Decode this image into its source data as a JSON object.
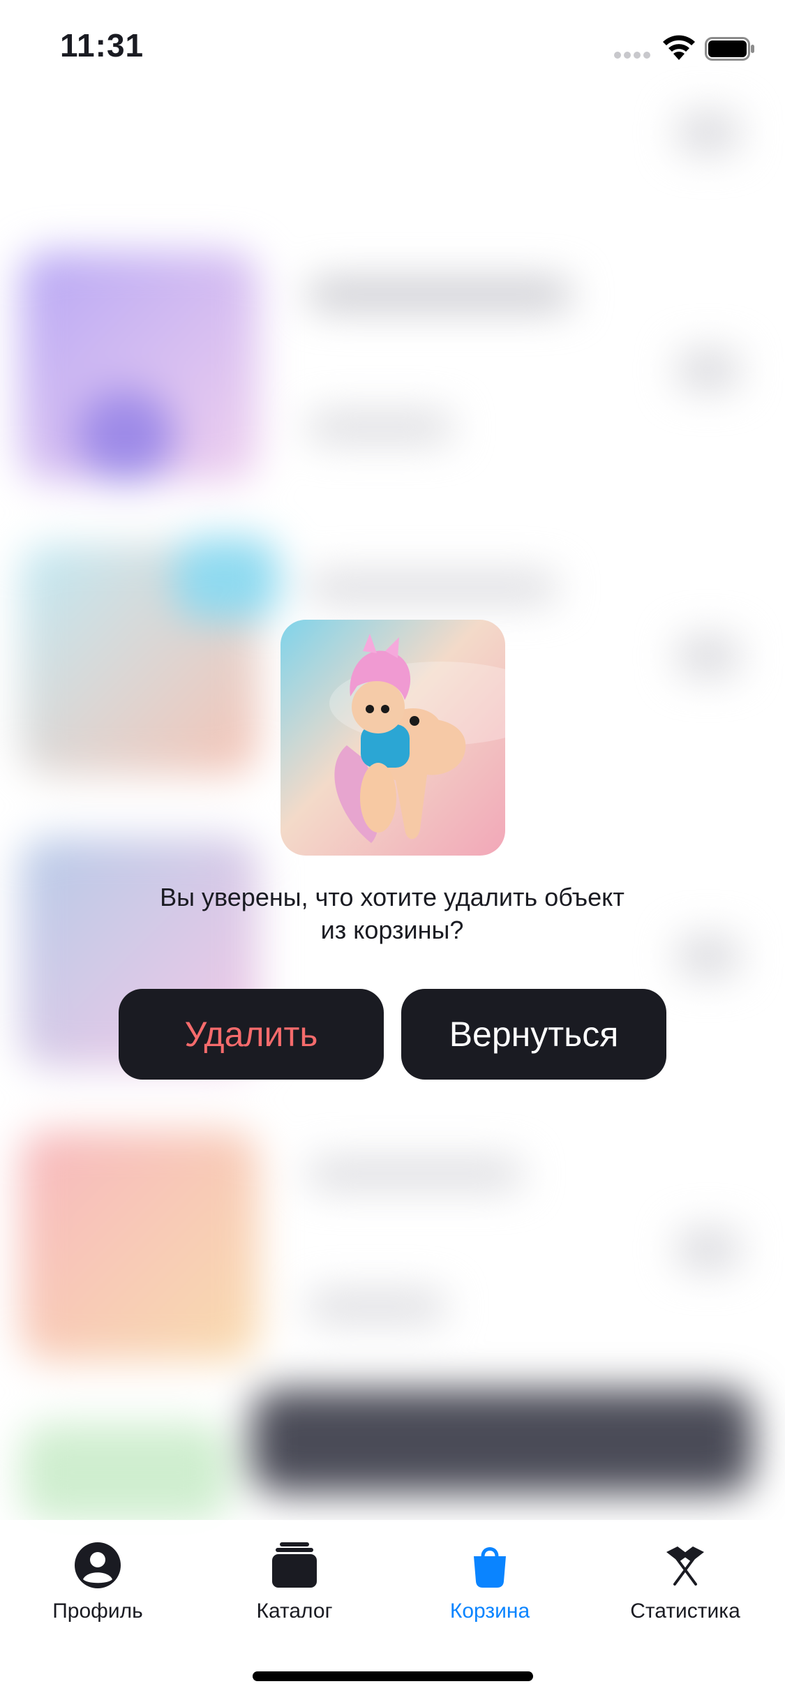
{
  "status_bar": {
    "time": "11:31"
  },
  "dialog": {
    "image_alt": "NFT",
    "message": "Вы уверены, что хотите удалить объект из корзины?",
    "delete_label": "Удалить",
    "back_label": "Вернуться",
    "delete_color": "#F56B6C",
    "button_color": "#1A1B22"
  },
  "tab_bar": {
    "items": [
      {
        "label": "Профиль",
        "icon": "person-circle-icon",
        "active": false
      },
      {
        "label": "Каталог",
        "icon": "stack-icon",
        "active": false
      },
      {
        "label": "Корзина",
        "icon": "bag-icon",
        "active": true
      },
      {
        "label": "Статистика",
        "icon": "flags-icon",
        "active": false
      }
    ],
    "active_color": "#0A84FF"
  }
}
